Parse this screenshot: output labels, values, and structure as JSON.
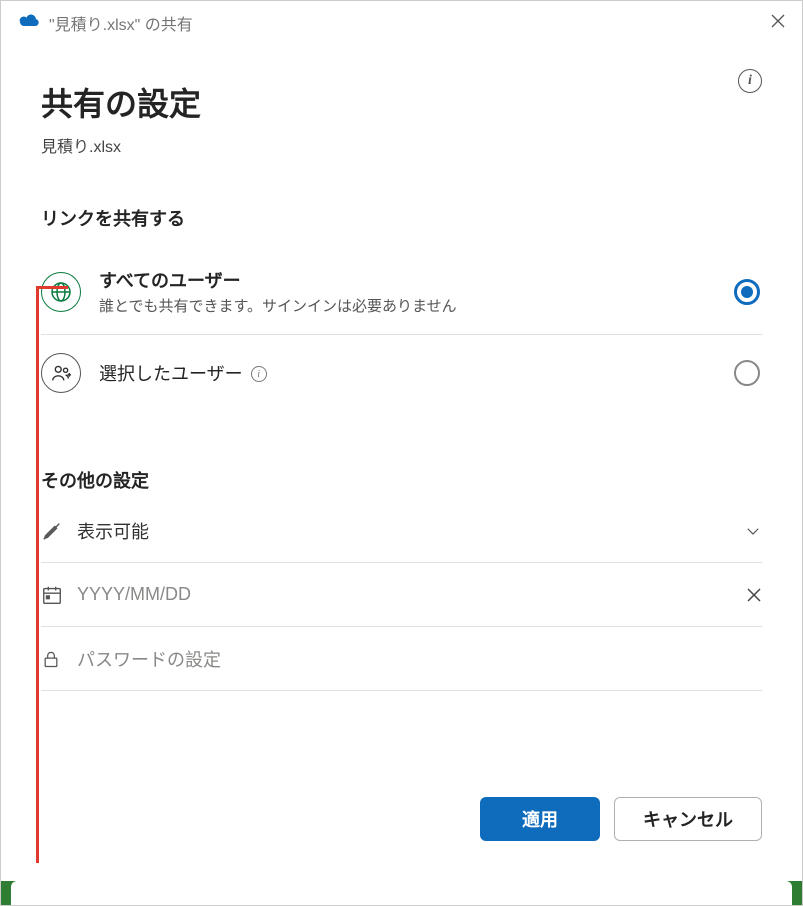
{
  "titlebar": {
    "text": "\"見積り.xlsx\" の共有"
  },
  "header": {
    "title": "共有の設定",
    "filename": "見積り.xlsx"
  },
  "sections": {
    "share_link": "リンクを共有する",
    "other": "その他の設定"
  },
  "options": {
    "all_users": {
      "title": "すべてのユーザー",
      "desc": "誰とでも共有できます。サインインは必要ありません",
      "selected": true
    },
    "selected_users": {
      "title": "選択したユーザー",
      "selected": false
    }
  },
  "settings": {
    "permission": {
      "label": "表示可能"
    },
    "date": {
      "placeholder": "YYYY/MM/DD"
    },
    "password": {
      "placeholder": "パスワードの設定"
    }
  },
  "buttons": {
    "apply": "適用",
    "cancel": "キャンセル"
  }
}
